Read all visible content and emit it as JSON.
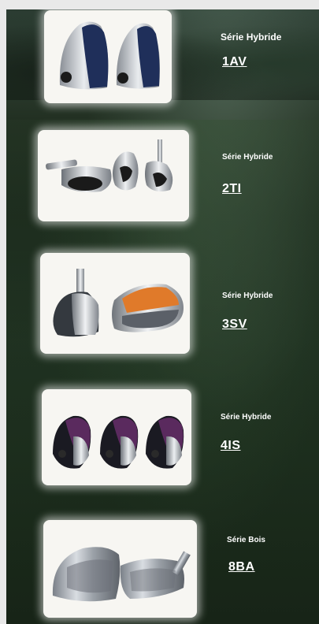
{
  "products": [
    {
      "series": "Série Hybride",
      "code": "1AV",
      "image_icon": "hybrid-clubheads-1av-icon"
    },
    {
      "series": "Série Hybride",
      "code": "2TI",
      "image_icon": "hybrid-clubheads-2ti-icon"
    },
    {
      "series": "Série Hybride",
      "code": "3SV",
      "image_icon": "hybrid-clubheads-3sv-icon"
    },
    {
      "series": "Série Hybride",
      "code": "4IS",
      "image_icon": "hybrid-clubheads-4is-icon"
    },
    {
      "series": "Série Bois",
      "code": "8BA",
      "image_icon": "wood-clubheads-8ba-icon"
    }
  ],
  "colors": {
    "text": "#ffffff",
    "thumb_bg": "#f7f6f2",
    "accent_navy": "#1f2f5a",
    "accent_orange": "#e07a2a",
    "accent_purple": "#5a2a5e"
  }
}
